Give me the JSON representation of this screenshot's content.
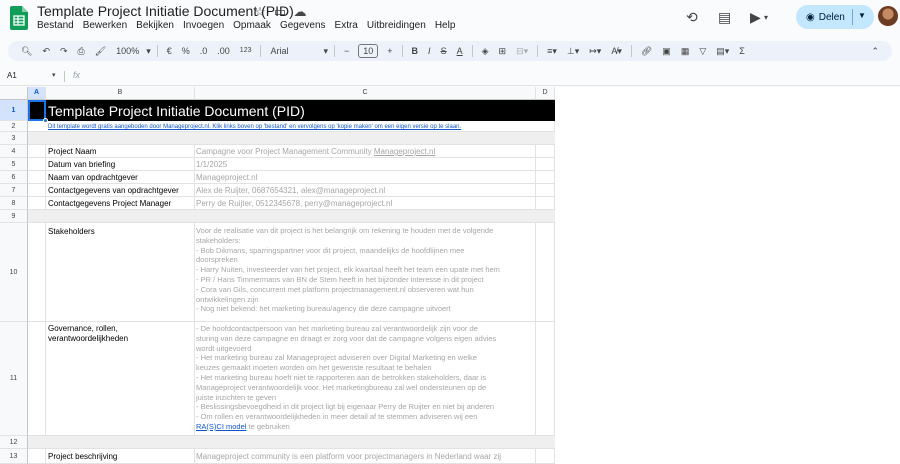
{
  "app": {
    "doc_title": "Template Project Initiatie Document (PID)",
    "menu": [
      "Bestand",
      "Bewerken",
      "Bekijken",
      "Invoegen",
      "Opmaak",
      "Gegevens",
      "Extra",
      "Uitbreidingen",
      "Help"
    ],
    "share_label": "Delen",
    "accent_color": "#c2e7ff"
  },
  "toolbar": {
    "zoom": "100%",
    "currency": "€",
    "percent": "%",
    "dec_decrease": ".0",
    "dec_increase": ".00",
    "format_123": "123",
    "font": "Arial",
    "font_size": "10",
    "bold": "B",
    "italic": "I",
    "strike": "S",
    "text_color": "A",
    "sigma": "Σ"
  },
  "formula_bar": {
    "cell_ref": "A1",
    "fx": "fx"
  },
  "columns": [
    "A",
    "B",
    "C",
    "D"
  ],
  "rows": [
    "1",
    "2",
    "3",
    "4",
    "5",
    "6",
    "7",
    "8",
    "9",
    "10",
    "11",
    "12",
    "13"
  ],
  "sheet": {
    "title": "Template Project Initiatie Document (PID)",
    "intro_link": "Dit template wordt gratis aangeboden door Manageproject.nl. Klik links boven op 'bestand' en vervolgens op 'kopie maken' om een eigen versie op te slaan.",
    "fields": [
      {
        "label": "Project Naam",
        "value": "Campagne voor Project Management Community ",
        "value_link": "Manageproject.nl"
      },
      {
        "label": "Datum van briefing",
        "value": "1/1/2025"
      },
      {
        "label": "Naam van opdrachtgever",
        "value": "Manageproject.nl"
      },
      {
        "label": "Contactgegevens van opdrachtgever",
        "value": "Alex de Ruijter, 0687654321, alex@manageproject.nl"
      },
      {
        "label": "Contactgegevens Project Manager",
        "value": "Perry de Ruijter, 0512345678, perry@manageproject.nl"
      }
    ],
    "stakeholders": {
      "label": "Stakeholders",
      "lines": [
        "Voor de realisatie van dit project is het belangrijk om rekening te houden met de volgende",
        "stakeholders:",
        "- Bob Dikmans, sparringspartner voor dit project, maandelijks de hoofdlijnen mee",
        "doorspreken",
        "- Harry Nuiten, investeerder van het project, elk kwartaal heeft het team een upate met hem",
        "- PR / Hans Timmermans van BN de Stem heeft in het bijzonder interesse in dit project",
        "- Cora van Gils, concurrent met platform projectmanagement.nl observeren wat hun",
        "ontwikkelingen zijn",
        "- Nog niet bekend: het marketing bureau/agency die deze campagne uitvoert"
      ]
    },
    "governance": {
      "label_lines": [
        "Governance, rollen,",
        "verantwoordelijkheden"
      ],
      "lines": [
        "- De hoofdcontactpersoon van het marketing bureau zal verantwoordelijk zijn voor de",
        "sturing van deze campagne en draagt er zorg voor dat de campagne volgens eigen advies",
        "wordt uitgevoerd",
        "- Het marketing bureau zal Manageproject adviseren over Digital Marketing en welke",
        "keuzes gemaakt moeten worden om het gewenste resultaat te behalen",
        "- Het marketing bureau hoeft niet te rapporteren aan de betrokken stakeholders, daar is",
        "Manageproject verantwoordelijk voor. Het marketingbureau zal wel ondersteunen op de",
        "juiste inzichten te geven",
        "- Beslissingsbevoegdheid in dit project ligt bij eigenaar Perry de Ruijter en niet bij anderen",
        "- Om rollen en verantwoordelijkheden in meer detail af te stemmen adviseren wij een"
      ],
      "link_text": "RA(S)CI model",
      "after_link": " te gebruiken"
    },
    "project_description": {
      "label": "Project beschrijving",
      "value": "Manageproject community is een platform voor projectmanagers in Nederland waar zij"
    }
  }
}
